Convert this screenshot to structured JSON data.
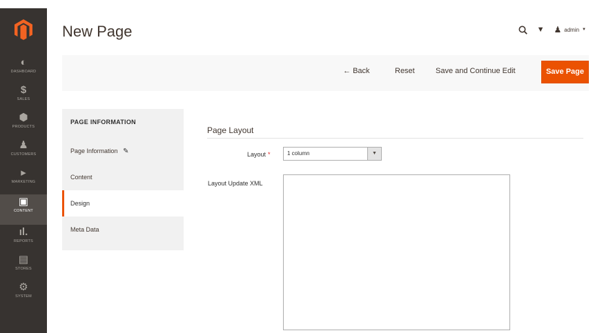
{
  "sidebar": {
    "items": [
      {
        "label": "DASHBOARD",
        "icon": "dashboard-icon"
      },
      {
        "label": "SALES",
        "icon": "dollar-icon"
      },
      {
        "label": "PRODUCTS",
        "icon": "cube-icon"
      },
      {
        "label": "CUSTOMERS",
        "icon": "person-icon"
      },
      {
        "label": "MARKETING",
        "icon": "megaphone-icon"
      },
      {
        "label": "CONTENT",
        "icon": "layout-icon"
      },
      {
        "label": "REPORTS",
        "icon": "bar-chart-icon"
      },
      {
        "label": "STORES",
        "icon": "store-icon"
      },
      {
        "label": "SYSTEM",
        "icon": "gear-icon"
      }
    ],
    "active": "CONTENT"
  },
  "header": {
    "title": "New Page",
    "user": "admin"
  },
  "actions": {
    "back": "Back",
    "reset": "Reset",
    "save_continue": "Save and Continue Edit",
    "save": "Save Page"
  },
  "tabs": {
    "title": "PAGE INFORMATION",
    "items": [
      "Page Information",
      "Content",
      "Design",
      "Meta Data"
    ],
    "active": "Design"
  },
  "section": {
    "title": "Page Layout",
    "layout_label": "Layout",
    "layout_value": "1 column",
    "xml_label": "Layout Update XML",
    "xml_value": ""
  },
  "colors": {
    "accent": "#eb5202",
    "sidebar": "#373330"
  }
}
